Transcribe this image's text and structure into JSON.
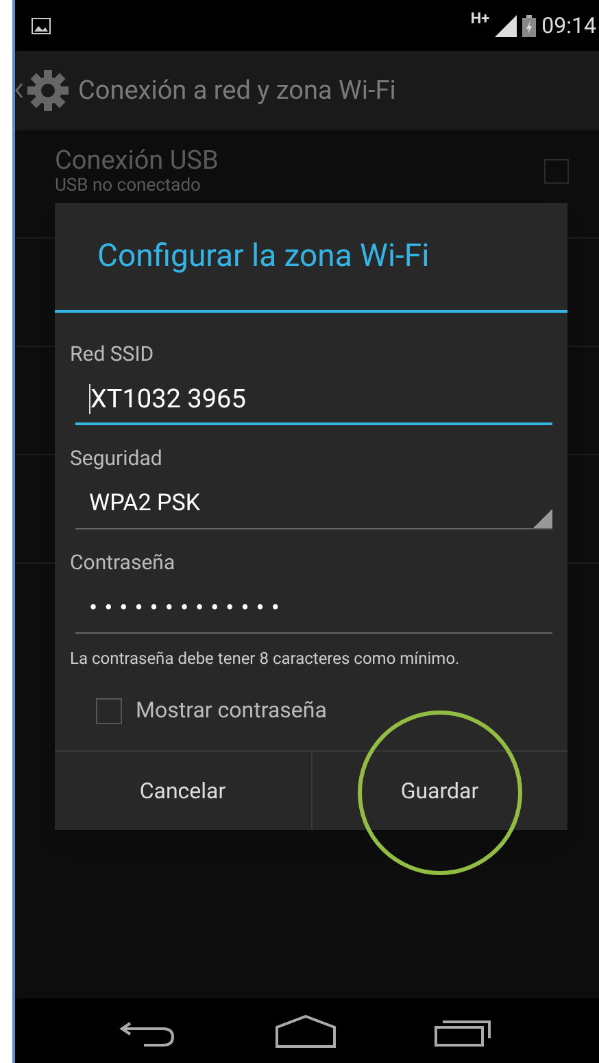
{
  "status_bar": {
    "network": "H+",
    "time": "09:14"
  },
  "action_bar": {
    "title": "Conexión a red y zona Wi-Fi"
  },
  "settings": [
    {
      "title": "Conexión USB",
      "subtitle": "USB no conectado",
      "checked": false
    }
  ],
  "dialog": {
    "title": "Configurar la zona Wi-Fi",
    "fields": [
      {
        "kind": "text",
        "label": "Red SSID",
        "value": "XT1032 3965",
        "focused": true
      },
      {
        "kind": "select",
        "label": "Seguridad",
        "value": "WPA2 PSK",
        "focused": false
      },
      {
        "kind": "password",
        "label": "Contraseña",
        "value": "•••••••••••••",
        "focused": false,
        "hint": "La contraseña debe tener 8 caracteres como mínimo."
      }
    ],
    "show_password": {
      "label": "Mostrar contraseña",
      "checked": false
    },
    "buttons": [
      {
        "label": "Cancelar",
        "highlighted": false
      },
      {
        "label": "Guardar",
        "highlighted": true
      }
    ]
  }
}
